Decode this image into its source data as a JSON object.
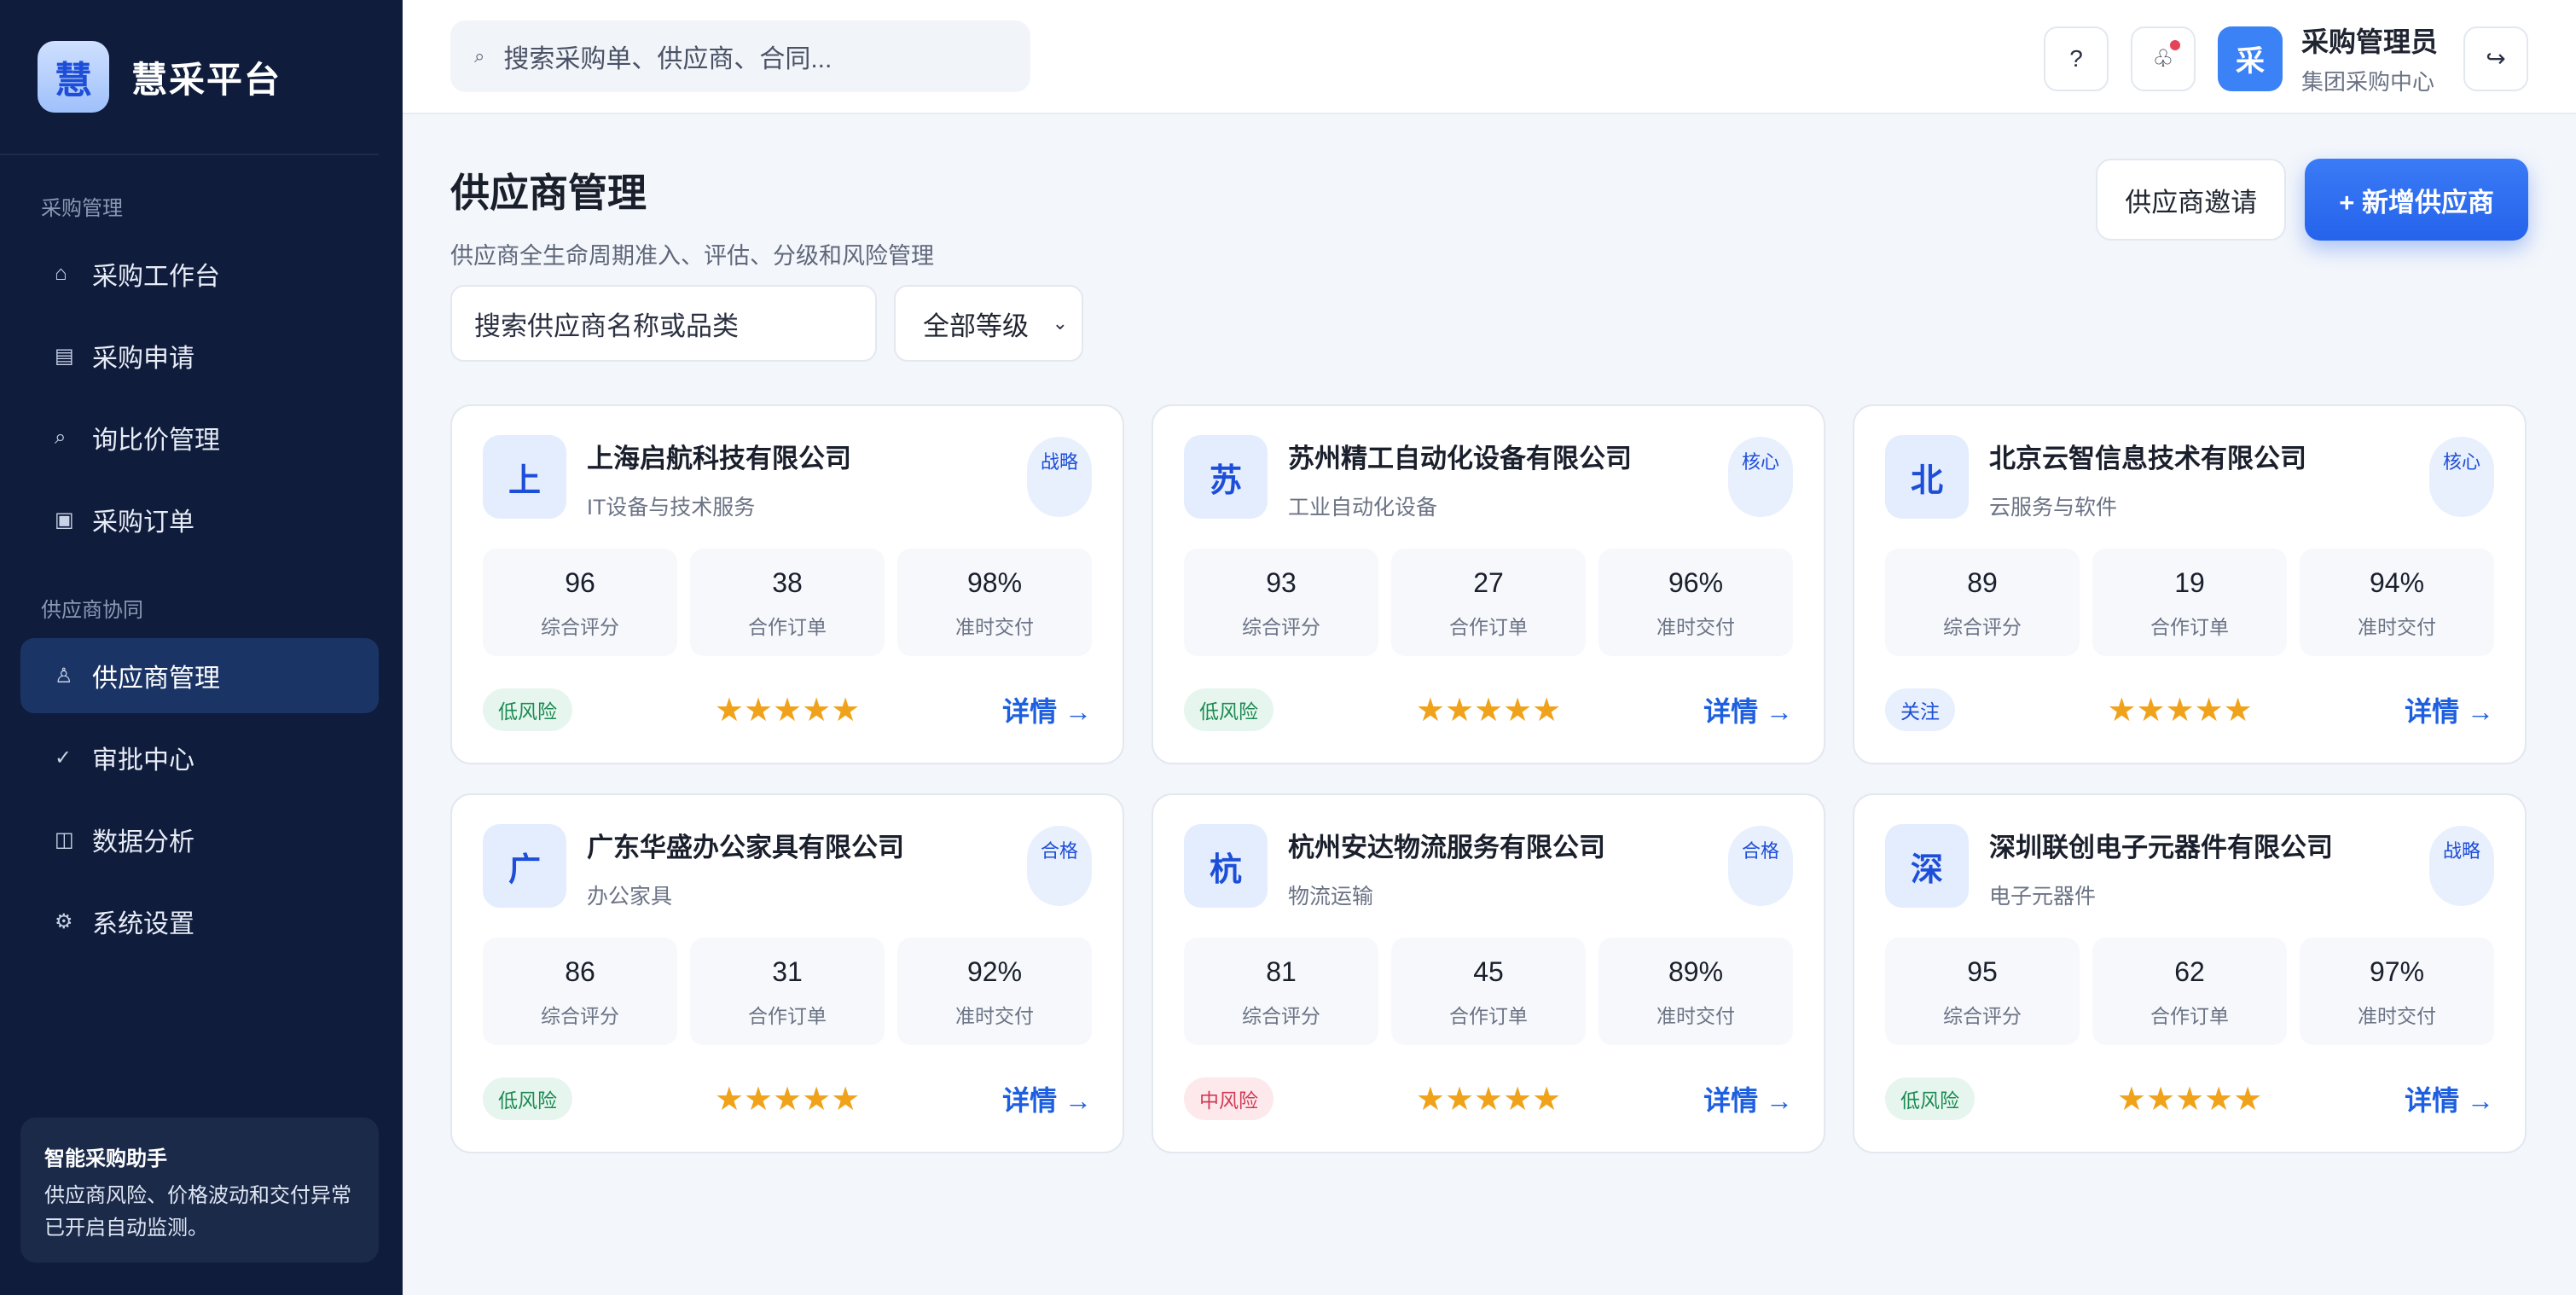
{
  "brand": {
    "logo": "慧",
    "name": "慧采平台"
  },
  "sidebar": {
    "groups": [
      {
        "label": "采购管理",
        "items": [
          {
            "icon": "⌂",
            "label": "采购工作台"
          },
          {
            "icon": "▤",
            "label": "采购申请"
          },
          {
            "icon": "⌕",
            "label": "询比价管理"
          },
          {
            "icon": "▣",
            "label": "采购订单"
          }
        ]
      },
      {
        "label": "供应商协同",
        "items": [
          {
            "icon": "♙",
            "label": "供应商管理"
          },
          {
            "icon": "✓",
            "label": "审批中心"
          },
          {
            "icon": "◫",
            "label": "数据分析"
          },
          {
            "icon": "⚙",
            "label": "系统设置"
          }
        ]
      }
    ],
    "assistant": {
      "title": "智能采购助手",
      "text": "供应商风险、价格波动和交付异常已开启自动监测。"
    }
  },
  "topbar": {
    "search_icon": "⌕",
    "search_placeholder": "搜索采购单、供应商、合同...",
    "help_icon": "?",
    "notification_icon": "♧",
    "user": {
      "avatar": "采",
      "name": "采购管理员",
      "role": "集团采购中心"
    },
    "logout_icon": "↪"
  },
  "page": {
    "title": "供应商管理",
    "subtitle": "供应商全生命周期准入、评估、分级和风险管理",
    "invite_label": "供应商邀请",
    "add_label": "+ 新增供应商"
  },
  "filters": {
    "search_placeholder": "搜索供应商名称或品类",
    "level_selected": "全部等级",
    "chevron": "⌄"
  },
  "metric_labels": {
    "score": "综合评分",
    "orders": "合作订单",
    "ontime": "准时交付"
  },
  "detail_label": "详情 →",
  "stars_glyph": "★★★★★",
  "suppliers": [
    {
      "initial": "上",
      "name": "上海启航科技有限公司",
      "category": "IT设备与技术服务",
      "level": "战略",
      "score": "96",
      "orders": "38",
      "ontime": "98%",
      "risk": "低风险",
      "risk_type": "low",
      "rating": 5
    },
    {
      "initial": "苏",
      "name": "苏州精工自动化设备有限公司",
      "category": "工业自动化设备",
      "level": "核心",
      "score": "93",
      "orders": "27",
      "ontime": "96%",
      "risk": "低风险",
      "risk_type": "low",
      "rating": 5
    },
    {
      "initial": "北",
      "name": "北京云智信息技术有限公司",
      "category": "云服务与软件",
      "level": "核心",
      "score": "89",
      "orders": "19",
      "ontime": "94%",
      "risk": "关注",
      "risk_type": "watch",
      "rating": 5
    },
    {
      "initial": "广",
      "name": "广东华盛办公家具有限公司",
      "category": "办公家具",
      "level": "合格",
      "score": "86",
      "orders": "31",
      "ontime": "92%",
      "risk": "低风险",
      "risk_type": "low",
      "rating": 5
    },
    {
      "initial": "杭",
      "name": "杭州安达物流服务有限公司",
      "category": "物流运输",
      "level": "合格",
      "score": "81",
      "orders": "45",
      "ontime": "89%",
      "risk": "中风险",
      "risk_type": "mid",
      "rating": 5
    },
    {
      "initial": "深",
      "name": "深圳联创电子元器件有限公司",
      "category": "电子元器件",
      "level": "战略",
      "score": "95",
      "orders": "62",
      "ontime": "97%",
      "risk": "低风险",
      "risk_type": "low",
      "rating": 5
    }
  ]
}
